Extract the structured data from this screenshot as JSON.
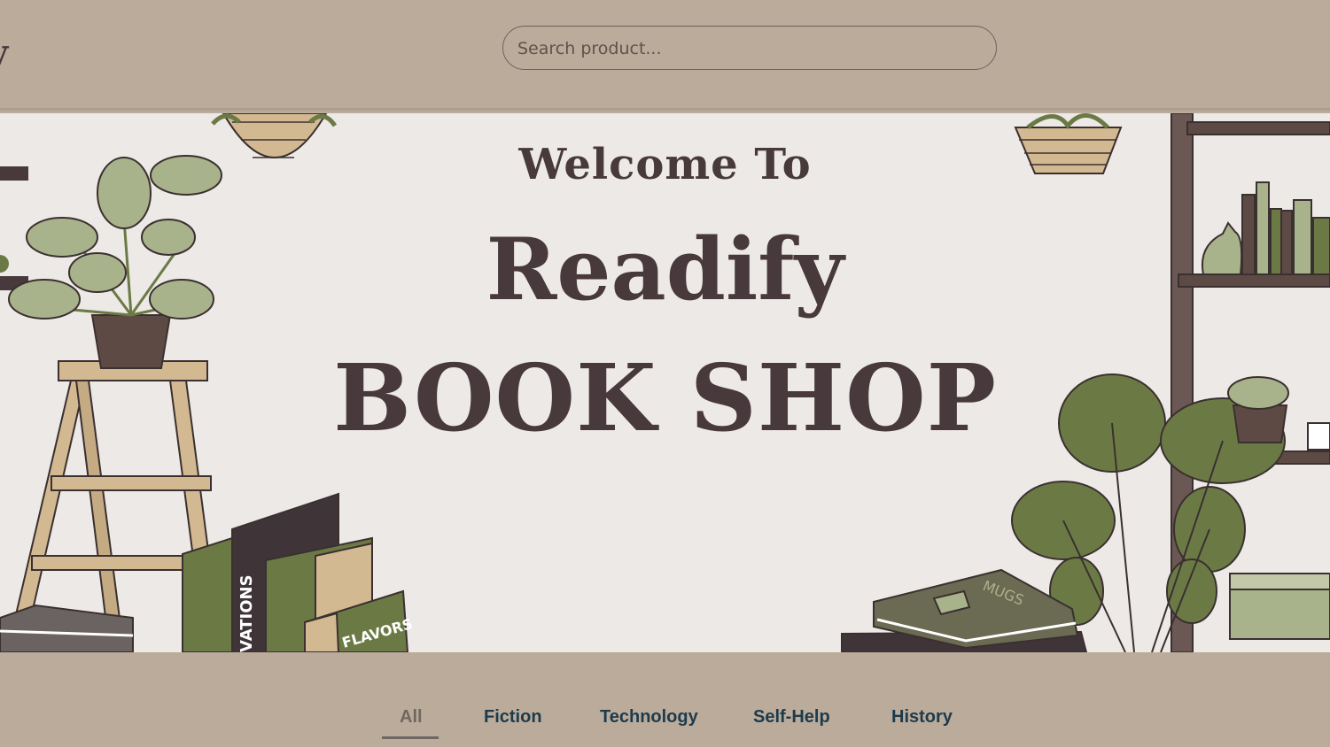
{
  "header": {
    "logo_fragment": "y",
    "search": {
      "placeholder": "Search product...",
      "value": ""
    }
  },
  "hero": {
    "welcome": "Welcome To",
    "brand": "Readify",
    "subtitle": "BOOK SHOP",
    "book_spine_texts": [
      "VATIONS",
      "FLAVORS",
      "MUGS"
    ]
  },
  "tabs": [
    {
      "label": "All",
      "active": true
    },
    {
      "label": "Fiction",
      "active": false
    },
    {
      "label": "Technology",
      "active": false
    },
    {
      "label": "Self-Help",
      "active": false
    },
    {
      "label": "History",
      "active": false
    }
  ],
  "colors": {
    "header_bg": "#bbab9b",
    "hero_bg": "#ede9e6",
    "title_text": "#47393c",
    "tab_text": "#1d3b4b",
    "tab_active": "#6f6860"
  }
}
